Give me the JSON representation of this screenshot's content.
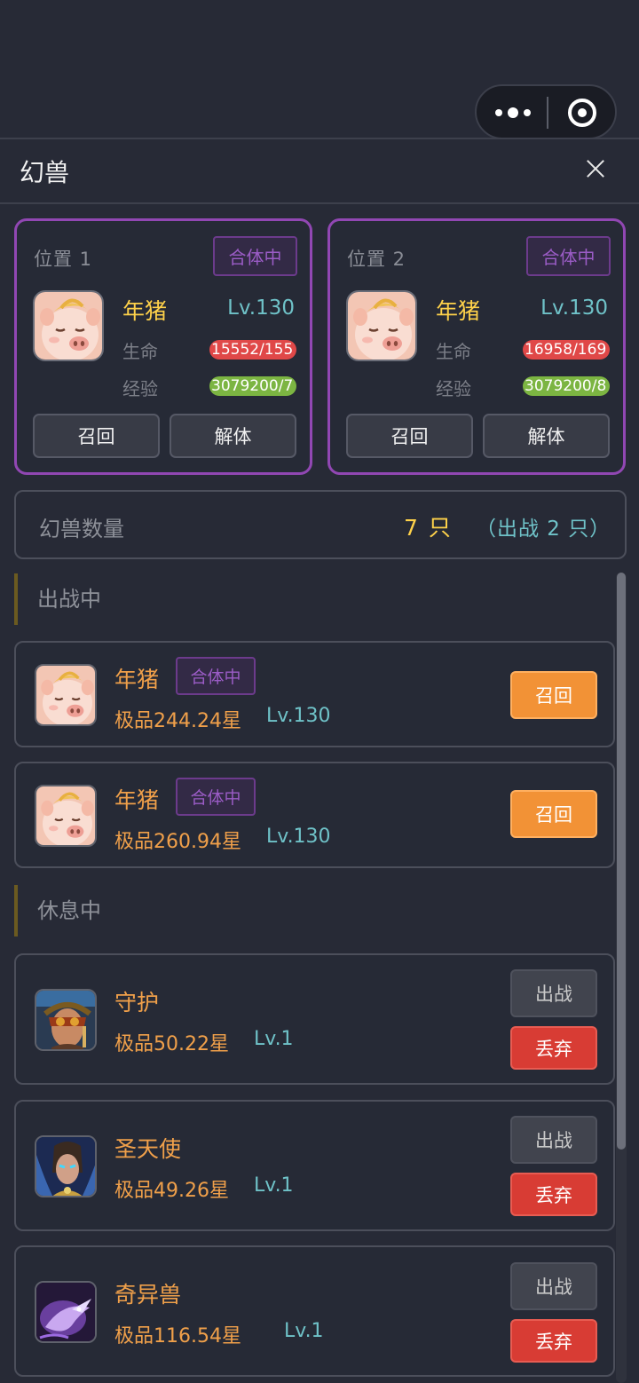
{
  "header": {
    "title": "幻兽"
  },
  "slots": [
    {
      "position": "位置 1",
      "badge": "合体中",
      "name": "年猪",
      "level": "Lv.130",
      "hp_label": "生命",
      "hp": "15552/155",
      "exp_label": "经验",
      "exp": "3079200/7",
      "recall": "召回",
      "unmerge": "解体",
      "avatar_icon": "pig-avatar-icon"
    },
    {
      "position": "位置 2",
      "badge": "合体中",
      "name": "年猪",
      "level": "Lv.130",
      "hp_label": "生命",
      "hp": "16958/169",
      "exp_label": "经验",
      "exp": "3079200/8",
      "recall": "召回",
      "unmerge": "解体",
      "avatar_icon": "pig-avatar-icon"
    }
  ],
  "count": {
    "label": "幻兽数量",
    "value": "7 只",
    "sub": "（出战 2 只）"
  },
  "sections": {
    "active": "出战中",
    "resting": "休息中"
  },
  "active_pets": [
    {
      "name": "年猪",
      "badge": "合体中",
      "quality": "极品244.24星",
      "level": "Lv.130",
      "action": "召回",
      "avatar_icon": "pig-avatar-icon"
    },
    {
      "name": "年猪",
      "badge": "合体中",
      "quality": "极品260.94星",
      "level": "Lv.130",
      "action": "召回",
      "avatar_icon": "pig-avatar-icon"
    }
  ],
  "resting_pets": [
    {
      "name": "守护",
      "quality": "极品50.22星",
      "level": "Lv.1",
      "deploy": "出战",
      "discard": "丢弃",
      "avatar_icon": "guardian-avatar-icon"
    },
    {
      "name": "圣天使",
      "quality": "极品49.26星",
      "level": "Lv.1",
      "deploy": "出战",
      "discard": "丢弃",
      "avatar_icon": "angel-avatar-icon"
    },
    {
      "name": "奇异兽",
      "quality": "极品116.54星",
      "level": "Lv.1",
      "deploy": "出战",
      "discard": "丢弃",
      "avatar_icon": "beast-avatar-icon"
    }
  ],
  "colors": {
    "accent_purple": "#9147b3",
    "gold": "#ffd24a",
    "orange": "#f0a04a",
    "teal": "#6fc2c8",
    "recall_button": "#f29236",
    "discard_button": "#d83c34"
  }
}
